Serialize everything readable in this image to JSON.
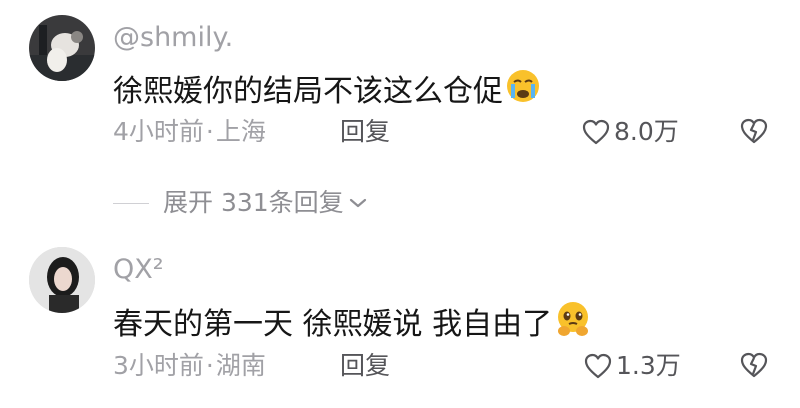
{
  "comments": [
    {
      "username": "@shmily.",
      "text": "徐熙媛你的结局不该这么仓促",
      "emoji": "loudly-crying-face",
      "time": "4小时前",
      "location": "上海",
      "reply_label": "回复",
      "like_count": "8.0万"
    },
    {
      "username": "QX²",
      "text": "春天的第一天 徐熙媛说 我自由了",
      "emoji": "face-holding-back-tears",
      "time": "3小时前",
      "location": "湖南",
      "reply_label": "回复",
      "like_count": "1.3万"
    }
  ],
  "expand_replies": {
    "label": "展开 331条回复"
  },
  "meta_separator": "·",
  "colors": {
    "text_primary": "#161616",
    "text_secondary": "#a1a1a6",
    "action": "#555559",
    "emoji_yellow": "#f9c12b"
  }
}
